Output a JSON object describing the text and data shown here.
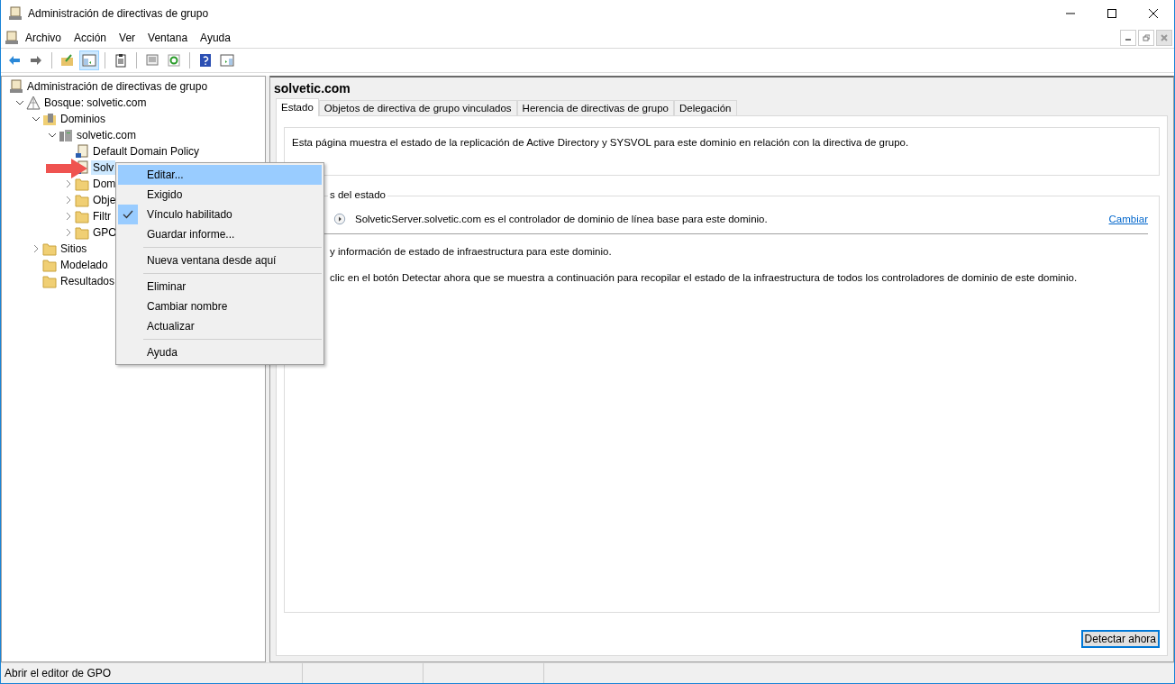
{
  "window": {
    "title": "Administración de directivas de grupo"
  },
  "menu_bar": [
    "Archivo",
    "Acción",
    "Ver",
    "Ventana",
    "Ayuda"
  ],
  "toolbar_groups": [
    [
      {
        "pressed": false
      },
      {
        "pressed": false
      }
    ],
    [
      {
        "pressed": false
      },
      {
        "pressed": true
      }
    ],
    [
      {
        "pressed": false
      }
    ],
    [
      {
        "pressed": false
      },
      {
        "pressed": false
      }
    ],
    [
      {
        "pressed": false
      },
      {
        "pressed": false
      }
    ]
  ],
  "tree": [
    {
      "label": "Administración de directivas de grupo",
      "kind": "console",
      "selected": false,
      "children": [
        {
          "label": "Bosque: solvetic.com",
          "kind": "forest",
          "selected": false,
          "expanded": true,
          "children": [
            {
              "label": "Dominios",
              "kind": "domains",
              "selected": false,
              "expanded": true,
              "children": [
                {
                  "label": "solvetic.com",
                  "kind": "domain",
                  "selected": false,
                  "expanded": true,
                  "children": [
                    {
                      "label": "Default Domain Policy",
                      "kind": "link",
                      "selected": false
                    },
                    {
                      "label": "Solv",
                      "kind": "link",
                      "selected": true
                    },
                    {
                      "label": "Dom",
                      "kind": "folder",
                      "selected": false,
                      "expanded": false
                    },
                    {
                      "label": "Obje",
                      "kind": "folder",
                      "selected": false,
                      "expanded": false
                    },
                    {
                      "label": "Filtr",
                      "kind": "folder",
                      "selected": false,
                      "expanded": false
                    },
                    {
                      "label": "GPO",
                      "kind": "folder",
                      "selected": false,
                      "expanded": false
                    }
                  ]
                }
              ]
            },
            {
              "label": "Sitios",
              "kind": "folder",
              "selected": false,
              "expanded": false
            },
            {
              "label": "Modelado",
              "kind": "folder",
              "selected": false
            },
            {
              "label": "Resultados",
              "kind": "folder",
              "selected": false
            }
          ]
        }
      ]
    }
  ],
  "context_menu": [
    {
      "kind": "item",
      "label": "Editar...",
      "selected": true,
      "checked": false
    },
    {
      "kind": "item",
      "label": "Exigido",
      "selected": false,
      "checked": false
    },
    {
      "kind": "item",
      "label": "Vínculo habilitado",
      "selected": false,
      "checked": true
    },
    {
      "kind": "item",
      "label": "Guardar informe...",
      "selected": false,
      "checked": false
    },
    {
      "kind": "separator"
    },
    {
      "kind": "item",
      "label": "Nueva ventana desde aquí",
      "selected": false,
      "checked": false
    },
    {
      "kind": "separator"
    },
    {
      "kind": "item",
      "label": "Eliminar",
      "selected": false,
      "checked": false
    },
    {
      "kind": "item",
      "label": "Cambiar nombre",
      "selected": false,
      "checked": false
    },
    {
      "kind": "item",
      "label": "Actualizar",
      "selected": false,
      "checked": false
    },
    {
      "kind": "separator"
    },
    {
      "kind": "item",
      "label": "Ayuda",
      "selected": false,
      "checked": false
    }
  ],
  "detail": {
    "title": "solvetic.com",
    "tabs": [
      {
        "label": "Estado",
        "selected": true
      },
      {
        "label": "Objetos de directiva de grupo vinculados",
        "selected": false
      },
      {
        "label": "Herencia de directivas de grupo",
        "selected": false
      },
      {
        "label": "Delegación",
        "selected": false
      }
    ],
    "description": "Esta página muestra el estado de la replicación de Active Directory y SYSVOL para este dominio en relación con la directiva de grupo.",
    "group_label": "s del estado",
    "baseline": "SolveticServer.solvetic.com es el controlador de dominio de línea base para este dominio.",
    "change_link": "Cambiar",
    "info_lines": [
      "y información de estado de infraestructura para este dominio.",
      "clic en el botón Detectar ahora que se muestra a continuación para recopilar el estado de la infraestructura de todos los controladores de dominio de este dominio."
    ],
    "detect_button": "Detectar ahora"
  },
  "status_bar": "Abrir el editor de GPO"
}
